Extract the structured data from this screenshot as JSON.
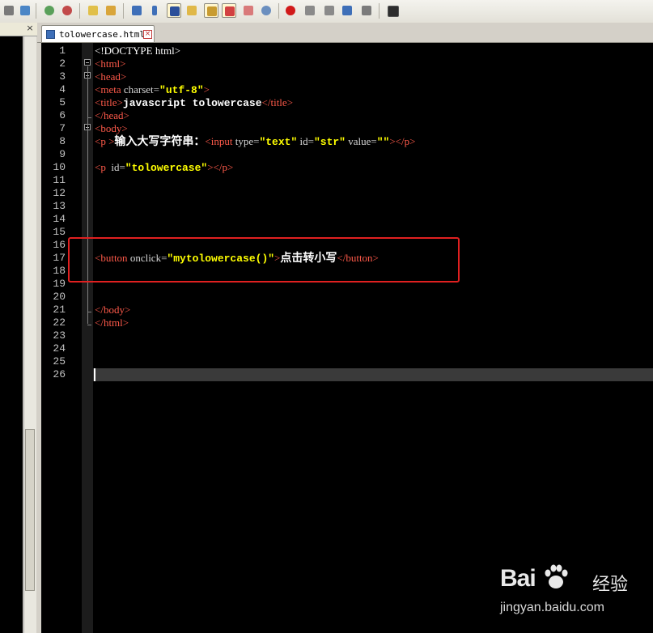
{
  "toolbar": {
    "icons": [
      "network-icon",
      "sync-icon",
      "zoom-in-icon",
      "zoom-out-icon",
      "window-icon",
      "window2-icon",
      "wrap-icon",
      "pilcrow-icon",
      "indent-guide-icon",
      "folder-icon",
      "chart-icon",
      "doc-icon",
      "panel-icon",
      "eye-icon",
      "record-macro-icon",
      "stop-icon",
      "play-icon",
      "fast-forward-icon",
      "save-macro-icon",
      "console-icon"
    ]
  },
  "side_panel": {
    "close_label": "×"
  },
  "tab": {
    "label": "tolowercase.html",
    "close": "×"
  },
  "editor": {
    "line_numbers": [
      "1",
      "2",
      "3",
      "4",
      "5",
      "6",
      "7",
      "8",
      "9",
      "10",
      "11",
      "12",
      "13",
      "14",
      "15",
      "16",
      "17",
      "18",
      "19",
      "20",
      "21",
      "22",
      "23",
      "24",
      "25",
      "26"
    ],
    "lines": {
      "l1": "<!DOCTYPE html>",
      "l2": "<html>",
      "l3": "<head>",
      "l4_open": "<meta",
      "l4_attr": " charset=",
      "l4_val": "\"utf-8\"",
      "l4_close": ">",
      "l5_open": "<title>",
      "l5_text": "javascript tolowercase",
      "l5_close": "</title>",
      "l6": "</head>",
      "l7": "<body>",
      "l8_open": "<p >",
      "l8_text": "输入大写字符串：",
      "l8_input": "<input",
      "l8_a1": " type=",
      "l8_v1": "\"text\"",
      "l8_a2": " id=",
      "l8_v2": "\"str\"",
      "l8_a3": " value=",
      "l8_v3": "\"\"",
      "l8_close": "></p>",
      "l10_open": "<p ",
      "l10_attr": " id=",
      "l10_val": "\"tolowercase\"",
      "l10_close": "></p>",
      "l17_open": "<button",
      "l17_attr": " onclick=",
      "l17_val": "\"mytolowercase()\"",
      "l17_gt": ">",
      "l17_text": "点击转小写",
      "l17_close": "</button>",
      "l21": "</body>",
      "l22": "</html>"
    }
  },
  "watermark": {
    "logo_left": "Bai",
    "logo_right": "经验",
    "url": "jingyan.baidu.com"
  },
  "colors": {
    "tag": "#ff5a4a",
    "attribute_value": "#ffff00",
    "highlight_box": "#e02020",
    "editor_bg": "#000000"
  }
}
